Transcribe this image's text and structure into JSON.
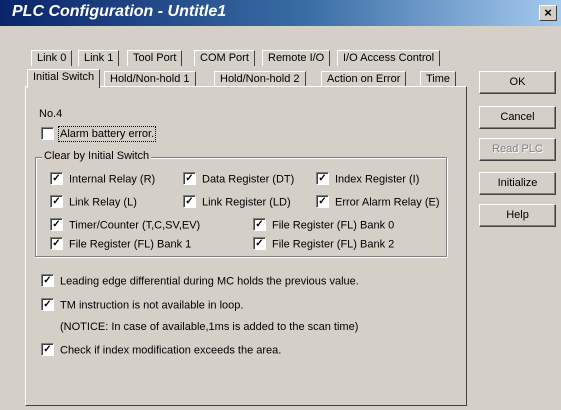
{
  "window": {
    "title": "PLC Configuration - Untitle1",
    "close_label": "×"
  },
  "tabs_row1": [
    "Link 0",
    "Link 1",
    "Tool Port",
    "COM Port",
    "Remote I/O",
    "I/O Access Control"
  ],
  "tabs_row2": [
    "Initial Switch",
    "Hold/Non-hold 1",
    "Hold/Non-hold 2",
    "Action on Error",
    "Time"
  ],
  "panel": {
    "number": "No.4",
    "alarm_battery": {
      "label": "Alarm battery error.",
      "checked": false
    },
    "group_title": "Clear by Initial Switch",
    "group_items": [
      {
        "label": "Internal Relay (R)",
        "checked": true
      },
      {
        "label": "Data Register (DT)",
        "checked": true
      },
      {
        "label": "Index Register (I)",
        "checked": true
      },
      {
        "label": "Link Relay (L)",
        "checked": true
      },
      {
        "label": "Link Register (LD)",
        "checked": true
      },
      {
        "label": "Error Alarm Relay (E)",
        "checked": true
      },
      {
        "label": "Timer/Counter (T,C,SV,EV)",
        "checked": true
      },
      {
        "label": "File Register (FL) Bank 0",
        "checked": true
      },
      {
        "label": "File Register (FL) Bank 1",
        "checked": true
      },
      {
        "label": "File Register (FL) Bank 2",
        "checked": true
      }
    ],
    "leading_edge": {
      "label": "Leading edge differential during MC holds the previous value.",
      "checked": true
    },
    "tm_instruction": {
      "label": "TM instruction is not available in loop.",
      "checked": true
    },
    "notice": "(NOTICE: In case of available,1ms is added to the scan time)",
    "index_check": {
      "label": "Check if index modification exceeds the area.",
      "checked": true
    }
  },
  "buttons": {
    "ok": "OK",
    "cancel": "Cancel",
    "read_plc": "Read PLC",
    "initialize": "Initialize",
    "help": "Help"
  },
  "colors": {
    "titlebar_start": "#0a246a",
    "titlebar_end": "#a6caf0",
    "face": "#d4d0c8"
  }
}
